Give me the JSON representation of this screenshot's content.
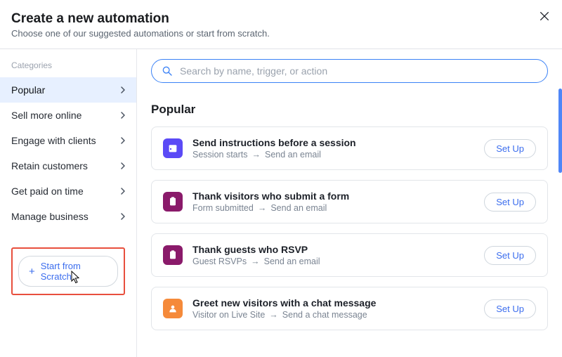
{
  "header": {
    "title": "Create a new automation",
    "subtitle": "Choose one of our suggested automations or start from scratch."
  },
  "sidebar": {
    "categories_label": "Categories",
    "items": [
      {
        "label": "Popular"
      },
      {
        "label": "Sell more online"
      },
      {
        "label": "Engage with clients"
      },
      {
        "label": "Retain customers"
      },
      {
        "label": "Get paid on time"
      },
      {
        "label": "Manage business"
      }
    ],
    "start_from_scratch": "Start from Scratch"
  },
  "search": {
    "placeholder": "Search by name, trigger, or action"
  },
  "section_title": "Popular",
  "setup_label": "Set Up",
  "cards": [
    {
      "icon": "calendar-icon",
      "icon_bg": "#5b4af6",
      "title": "Send instructions before a session",
      "trigger": "Session starts",
      "action": "Send an email"
    },
    {
      "icon": "clipboard-icon",
      "icon_bg": "#8a1a6a",
      "title": "Thank visitors who submit a form",
      "trigger": "Form submitted",
      "action": "Send an email"
    },
    {
      "icon": "clipboard-icon",
      "icon_bg": "#8a1a6a",
      "title": "Thank guests who RSVP",
      "trigger": "Guest RSVPs",
      "action": "Send an email"
    },
    {
      "icon": "chat-icon",
      "icon_bg": "#f58a3a",
      "title": "Greet new visitors with a chat message",
      "trigger": "Visitor on Live Site",
      "action": "Send a chat message"
    }
  ]
}
